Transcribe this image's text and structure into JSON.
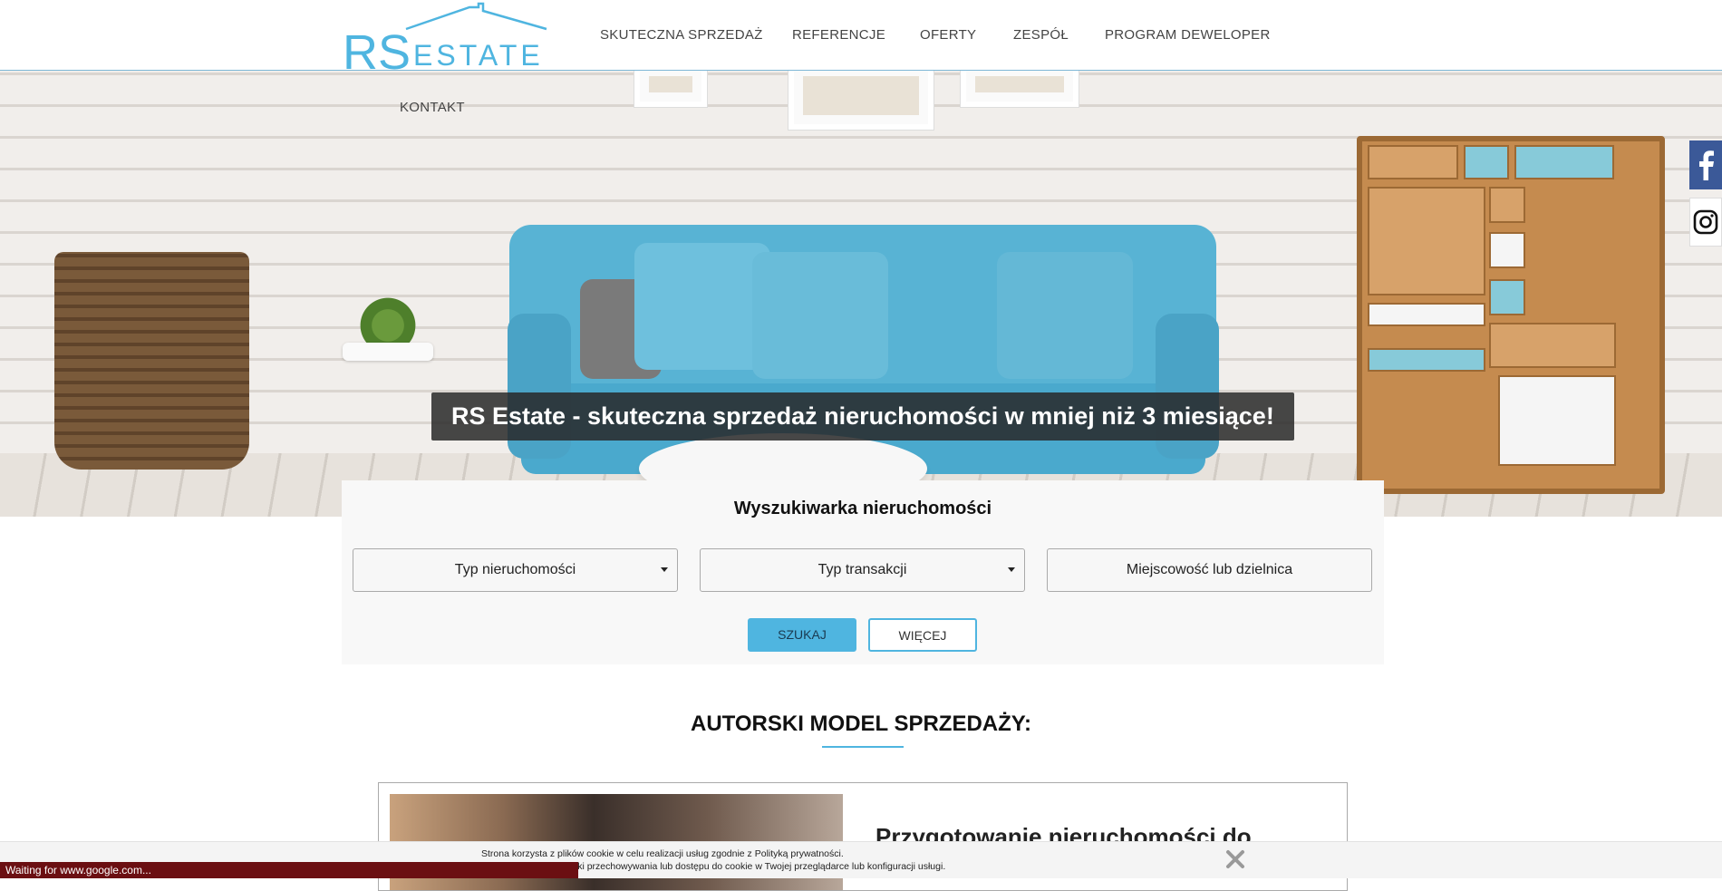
{
  "brand": {
    "logo_rs": "RS",
    "logo_estate": "ESTATE",
    "accent": "#4fb5e0"
  },
  "nav": {
    "items": [
      {
        "label": "SKUTECZNA SPRZEDAŻ"
      },
      {
        "label": "REFERENCJE"
      },
      {
        "label": "OFERTY"
      },
      {
        "label": "ZESPÓŁ"
      },
      {
        "label": "PROGRAM DEWELOPER"
      },
      {
        "label": "KONTAKT"
      }
    ]
  },
  "hero": {
    "title": "RS Estate - skuteczna sprzedaż nieruchomości w mniej niż 3 miesiące!"
  },
  "search": {
    "title": "Wyszukiwarka nieruchomości",
    "property_type": "Typ nieruchomości",
    "transaction_type": "Typ transakcji",
    "location_placeholder": "Miejscowość lub dzielnica",
    "search_button": "SZUKAJ",
    "more_button": "WIĘCEJ"
  },
  "section": {
    "title": "AUTORSKI MODEL SPRZEDAŻY:",
    "card_title": "Przygotowanie nieruchomości do"
  },
  "social": {
    "facebook": "facebook-icon",
    "instagram": "instagram-icon"
  },
  "cookie": {
    "line1": "Strona korzysta z plików cookie w celu realizacji usług zgodnie z Polityką prywatności.",
    "line2": "Możesz określić warunki przechowywania lub dostępu do cookie w Twojej przeglądarce lub konfiguracji usługi."
  },
  "status": "Waiting for www.google.com..."
}
